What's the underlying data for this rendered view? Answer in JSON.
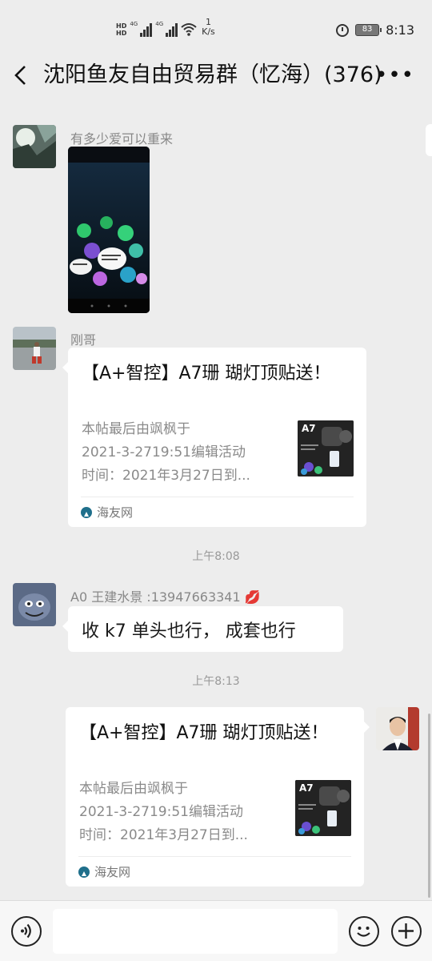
{
  "status_bar": {
    "hd1": "HD",
    "hd2": "HD",
    "net1": "4G",
    "net2": "4G",
    "speed_value": "1",
    "speed_unit": "K/s",
    "battery": "83",
    "clock": "8:13"
  },
  "header": {
    "title": "沈阳鱼友自由贸易群（忆海）(376)",
    "more_icon": "ellipsis-icon",
    "back_icon": "back-chevron-icon"
  },
  "messages": {
    "m1": {
      "sender": "有多少爱可以重来"
    },
    "m2": {
      "sender": "刚哥",
      "link_title": "【A+智控】A7珊 瑚灯顶贴送！",
      "link_desc": [
        "本帖最后由飒枫于",
        "2021-3-2719:51编辑活动",
        "时间：2021年3月27日到..."
      ],
      "source": "海友网",
      "thumb_label": "A7"
    },
    "time1": "上午8:08",
    "m3": {
      "sender": "A0   王建水景 :13947663341",
      "text": "收 k7  单头也行，  成套也行"
    },
    "time2": "上午8:13",
    "m4": {
      "link_title": "【A+智控】A7珊 瑚灯顶贴送！",
      "link_desc": [
        "本帖最后由飒枫于",
        "2021-3-2719:51编辑活动",
        "时间：2021年3月27日到..."
      ],
      "source": "海友网",
      "thumb_label": "A7"
    }
  },
  "input_bar": {
    "placeholder": "",
    "voice_icon": "voice-icon",
    "emoji_icon": "emoji-icon",
    "plus_icon": "plus-icon"
  },
  "colors": {
    "background": "#ededed",
    "bubble": "#ffffff",
    "meta_text": "#888888"
  }
}
